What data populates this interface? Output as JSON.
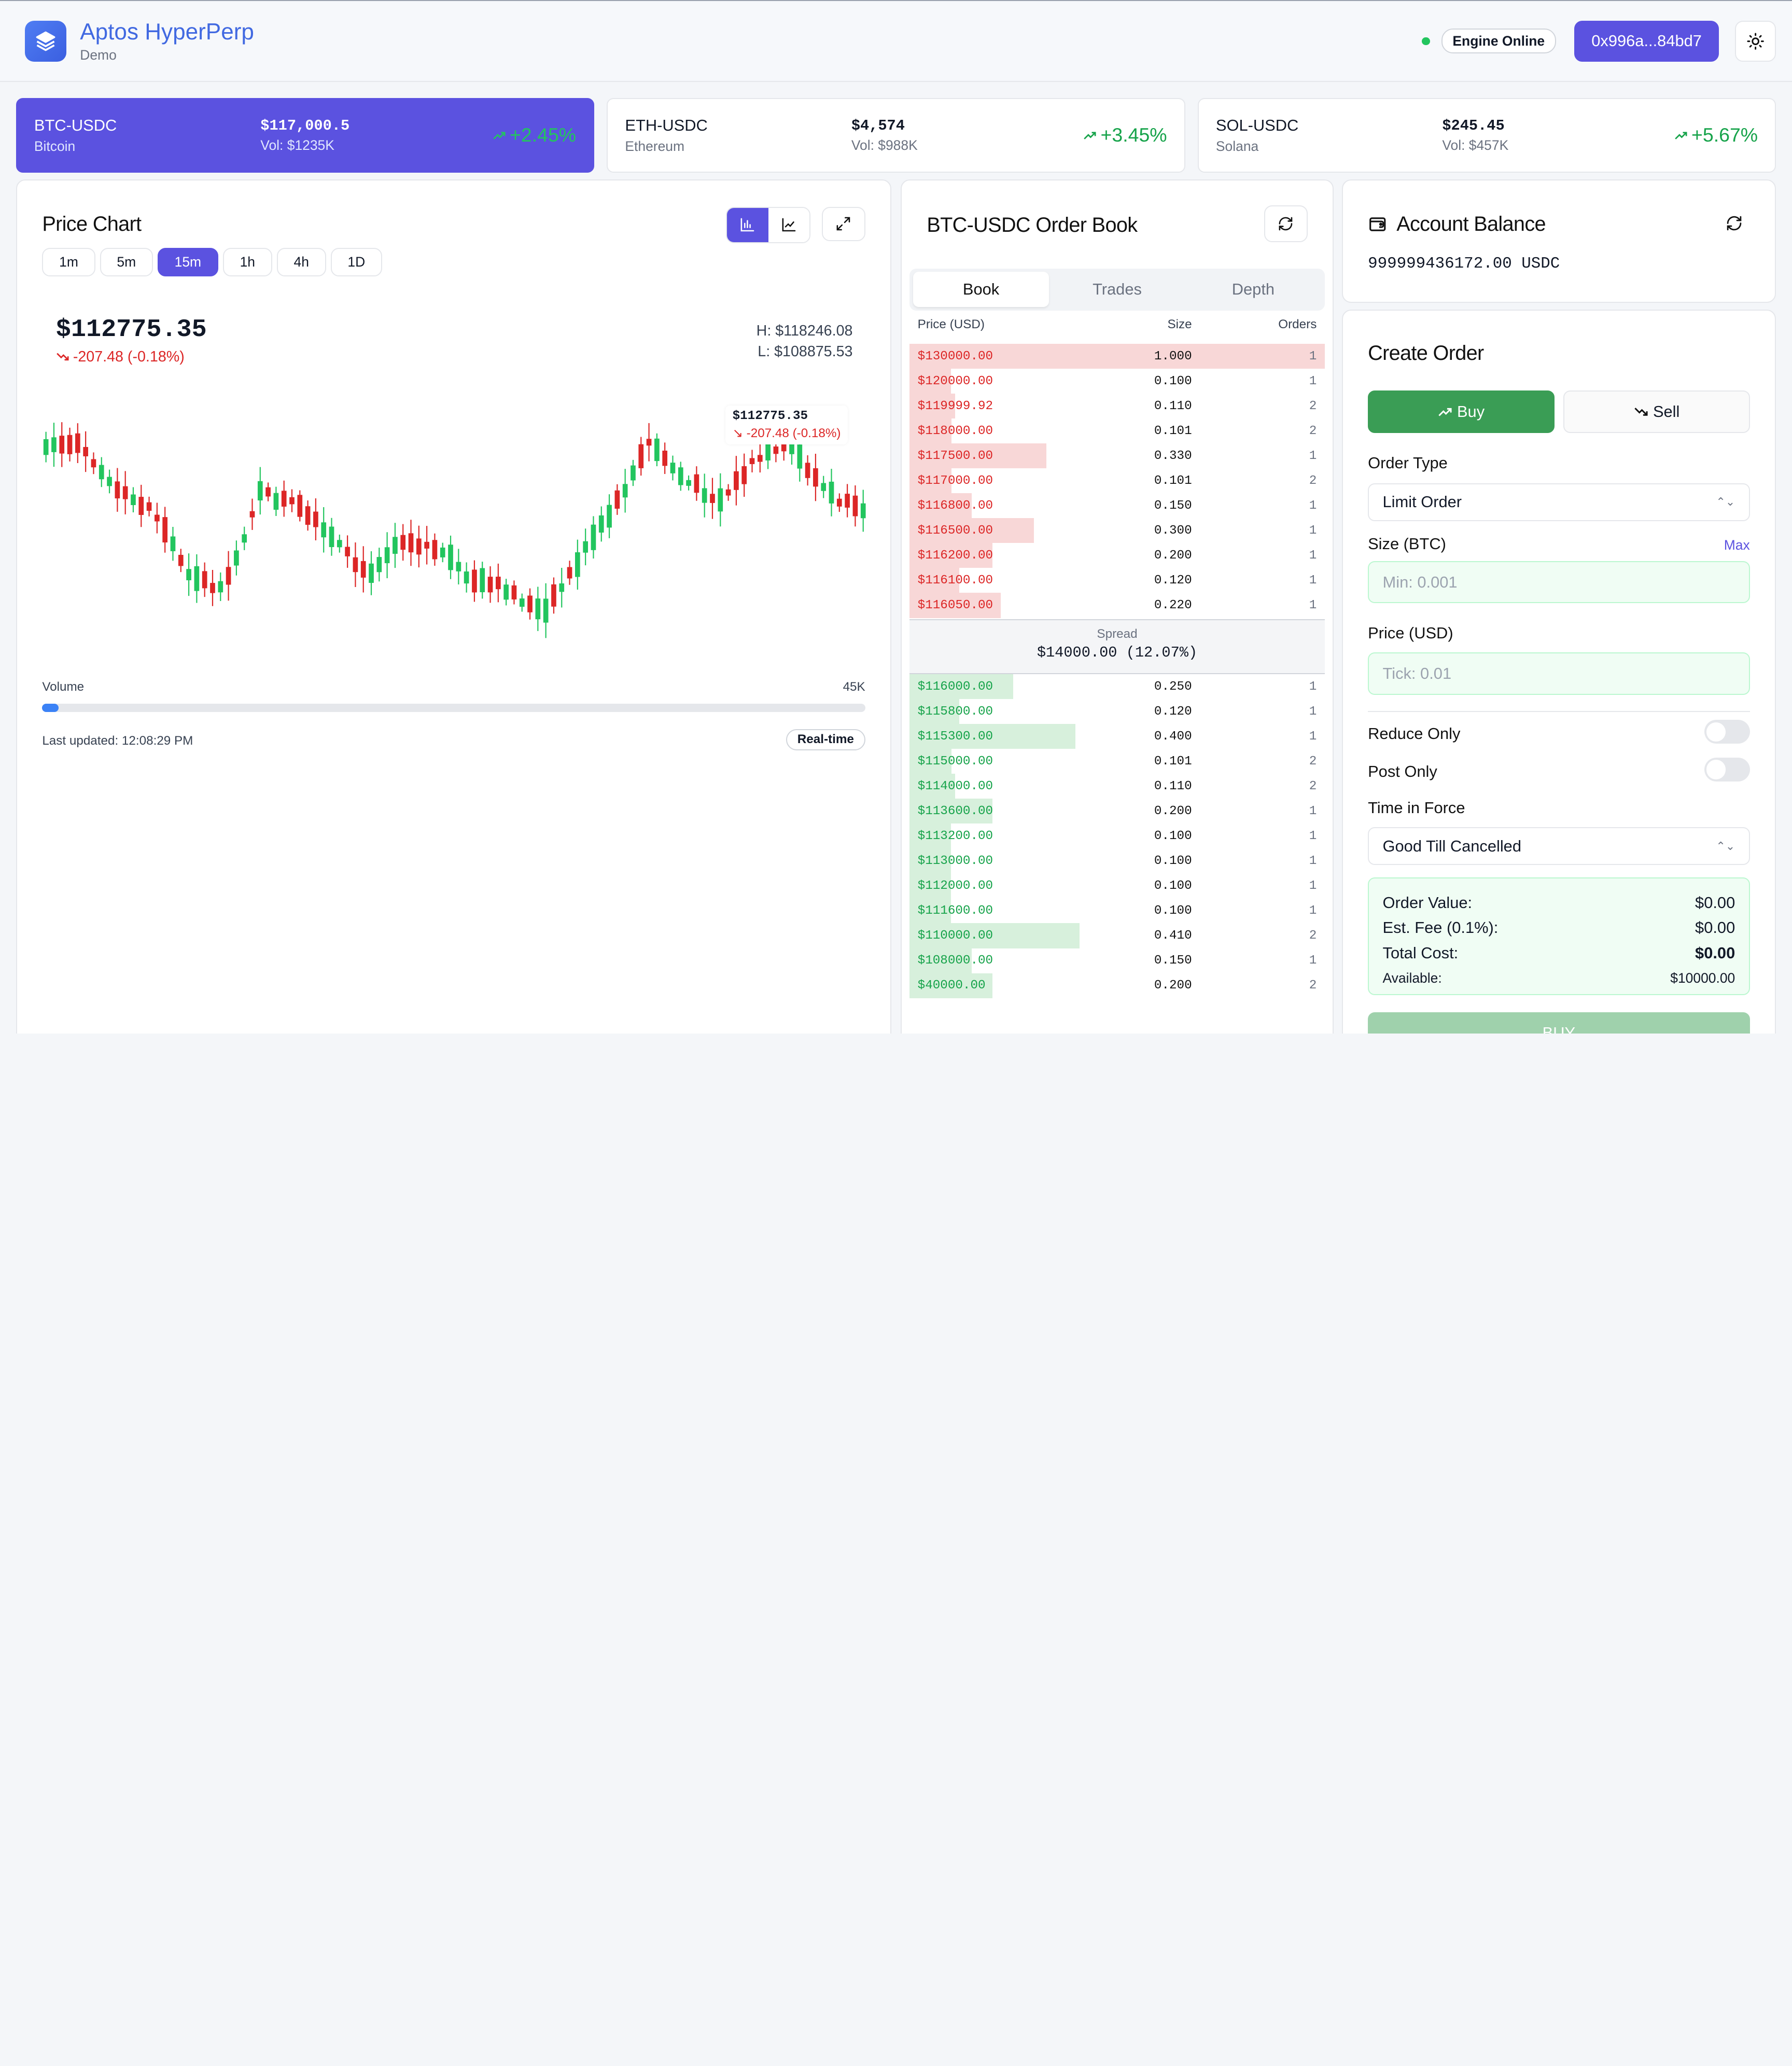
{
  "header": {
    "brand_title": "Aptos HyperPerp",
    "brand_sub": "Demo",
    "engine_status": "Engine Online",
    "wallet": "0x996a...84bd7"
  },
  "markets": [
    {
      "symbol": "BTC-USDC",
      "name": "Bitcoin",
      "price": "$117,000.5",
      "volume": "Vol: $1235K",
      "change": "+2.45%",
      "active": true
    },
    {
      "symbol": "ETH-USDC",
      "name": "Ethereum",
      "price": "$4,574",
      "volume": "Vol: $988K",
      "change": "+3.45%",
      "active": false
    },
    {
      "symbol": "SOL-USDC",
      "name": "Solana",
      "price": "$245.45",
      "volume": "Vol: $457K",
      "change": "+5.67%",
      "active": false
    }
  ],
  "chart": {
    "title": "Price Chart",
    "timeframes": [
      "1m",
      "5m",
      "15m",
      "1h",
      "4h",
      "1D"
    ],
    "active_timeframe": "15m",
    "price": "$112775.35",
    "change": "-207.48 (-0.18%)",
    "high": "H: $118246.08",
    "low": "L: $108875.53",
    "tooltip_price": "$112775.35",
    "tooltip_change": "-207.48 (-0.18%)",
    "volume_label": "Volume",
    "volume_max": "45K",
    "volume_fraction": 0.02,
    "last_updated": "Last updated: 12:08:29 PM",
    "realtime_label": "Real-time",
    "colors": {
      "up": "#22c55e",
      "down": "#dc2626",
      "accent": "#5b52e0"
    }
  },
  "order_book": {
    "title": "BTC-USDC Order Book",
    "tabs": [
      "Book",
      "Trades",
      "Depth"
    ],
    "active_tab": "Book",
    "columns": {
      "price": "Price (USD)",
      "size": "Size",
      "orders": "Orders"
    },
    "asks": [
      {
        "price": "$130000.00",
        "size": "1.000",
        "orders": "1",
        "depth": 1.0
      },
      {
        "price": "$120000.00",
        "size": "0.100",
        "orders": "1",
        "depth": 0.1
      },
      {
        "price": "$119999.92",
        "size": "0.110",
        "orders": "2",
        "depth": 0.11
      },
      {
        "price": "$118000.00",
        "size": "0.101",
        "orders": "2",
        "depth": 0.101
      },
      {
        "price": "$117500.00",
        "size": "0.330",
        "orders": "1",
        "depth": 0.33
      },
      {
        "price": "$117000.00",
        "size": "0.101",
        "orders": "2",
        "depth": 0.101
      },
      {
        "price": "$116800.00",
        "size": "0.150",
        "orders": "1",
        "depth": 0.15
      },
      {
        "price": "$116500.00",
        "size": "0.300",
        "orders": "1",
        "depth": 0.3
      },
      {
        "price": "$116200.00",
        "size": "0.200",
        "orders": "1",
        "depth": 0.2
      },
      {
        "price": "$116100.00",
        "size": "0.120",
        "orders": "1",
        "depth": 0.12
      },
      {
        "price": "$116050.00",
        "size": "0.220",
        "orders": "1",
        "depth": 0.22
      }
    ],
    "spread_label": "Spread",
    "spread_value": "$14000.00 (12.07%)",
    "bids": [
      {
        "price": "$116000.00",
        "size": "0.250",
        "orders": "1",
        "depth": 0.25
      },
      {
        "price": "$115800.00",
        "size": "0.120",
        "orders": "1",
        "depth": 0.12
      },
      {
        "price": "$115300.00",
        "size": "0.400",
        "orders": "1",
        "depth": 0.4
      },
      {
        "price": "$115000.00",
        "size": "0.101",
        "orders": "2",
        "depth": 0.101
      },
      {
        "price": "$114000.00",
        "size": "0.110",
        "orders": "2",
        "depth": 0.11
      },
      {
        "price": "$113600.00",
        "size": "0.200",
        "orders": "1",
        "depth": 0.2
      },
      {
        "price": "$113200.00",
        "size": "0.100",
        "orders": "1",
        "depth": 0.1
      },
      {
        "price": "$113000.00",
        "size": "0.100",
        "orders": "1",
        "depth": 0.1
      },
      {
        "price": "$112000.00",
        "size": "0.100",
        "orders": "1",
        "depth": 0.1
      },
      {
        "price": "$111600.00",
        "size": "0.100",
        "orders": "1",
        "depth": 0.1
      },
      {
        "price": "$110000.00",
        "size": "0.410",
        "orders": "2",
        "depth": 0.41
      },
      {
        "price": "$108000.00",
        "size": "0.150",
        "orders": "1",
        "depth": 0.15
      },
      {
        "price": "$40000.00",
        "size": "0.200",
        "orders": "2",
        "depth": 0.2
      }
    ]
  },
  "balance": {
    "title": "Account Balance",
    "value": "999999436172.00 USDC"
  },
  "create_order": {
    "title": "Create Order",
    "buy_label": "Buy",
    "sell_label": "Sell",
    "order_type_label": "Order Type",
    "order_type_value": "Limit Order",
    "size_label": "Size (BTC)",
    "max_label": "Max",
    "size_placeholder": "Min: 0.001",
    "price_label": "Price (USD)",
    "price_placeholder": "Tick: 0.01",
    "reduce_only_label": "Reduce Only",
    "post_only_label": "Post Only",
    "tif_label": "Time in Force",
    "tif_value": "Good Till Cancelled",
    "summary": {
      "order_value_label": "Order Value:",
      "order_value": "$0.00",
      "fee_label": "Est. Fee (0.1%):",
      "fee": "$0.00",
      "total_label": "Total Cost:",
      "total": "$0.00",
      "available_label": "Available:",
      "available": "$10000.00"
    },
    "submit_label": "BUY"
  }
}
